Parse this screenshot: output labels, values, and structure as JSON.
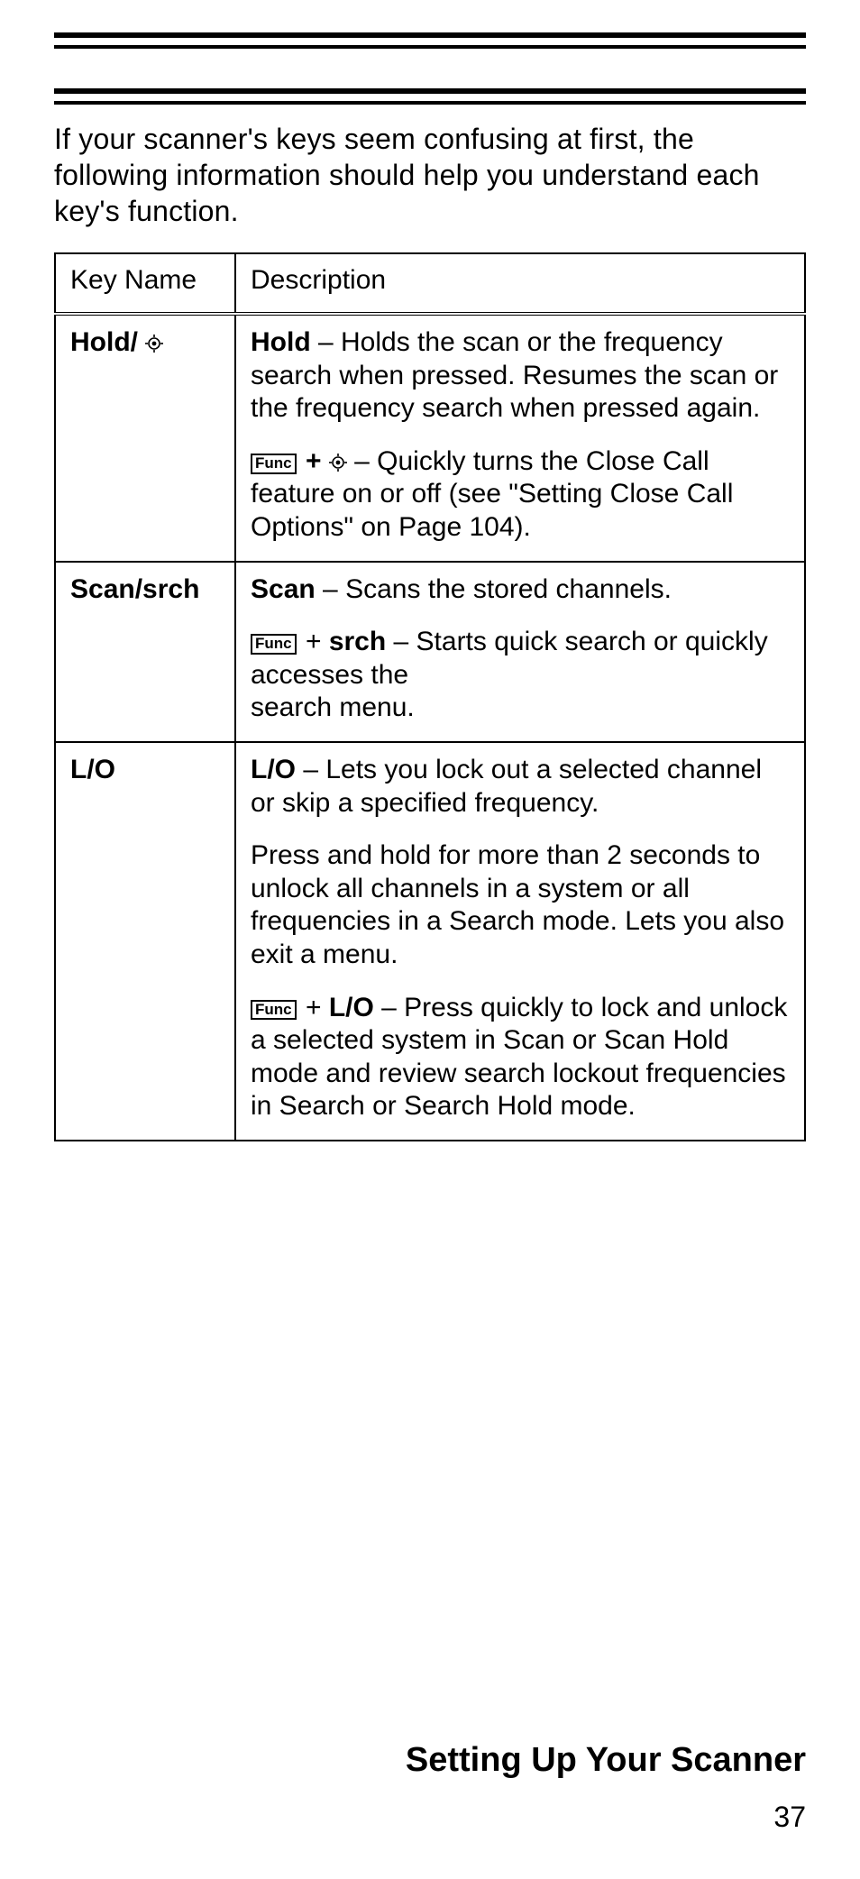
{
  "intro": "If your scanner's keys seem confusing at first, the following information should help you understand each key's function.",
  "table": {
    "headers": {
      "key": "Key Name",
      "desc": "Description"
    },
    "rows": {
      "hold": {
        "name_prefix": "Hold/ ",
        "d1_b": "Hold",
        "d1_rest": " – Holds the scan or the frequency search when pressed. Resumes the scan or the frequency search when pressed again.",
        "d2_func": "Func",
        "d2_mid": "  +  ",
        "d2_rest": "  – Quickly turns the Close Call feature on or off (see \"Setting Close Call Options\" on Page 104)."
      },
      "scan": {
        "name": "Scan/srch",
        "d1_b": "Scan",
        "d1_rest": " – Scans the stored channels.",
        "d2_func": "Func",
        "d2_mid": " + ",
        "d2_b": "srch",
        "d2_rest": " – Starts quick search or quickly accesses the",
        "d2_rest2": "search menu."
      },
      "lo": {
        "name": "L/O",
        "d1_b": "L/O",
        "d1_rest": " – Lets you lock out a selected channel or skip a specified frequency.",
        "d2": "Press and hold for more than 2 seconds to unlock all channels in a system or all frequencies in a Search mode. Lets you also exit a menu.",
        "d3_func": "Func",
        "d3_mid": " + ",
        "d3_b": "L/O",
        "d3_rest": " – Press quickly to lock and unlock a selected system in Scan or Scan Hold mode and review search lockout frequencies in Search or Search Hold mode."
      }
    }
  },
  "glyphs": {
    "func": "Func"
  },
  "footer": {
    "section": "Setting Up Your Scanner",
    "page": "37"
  }
}
